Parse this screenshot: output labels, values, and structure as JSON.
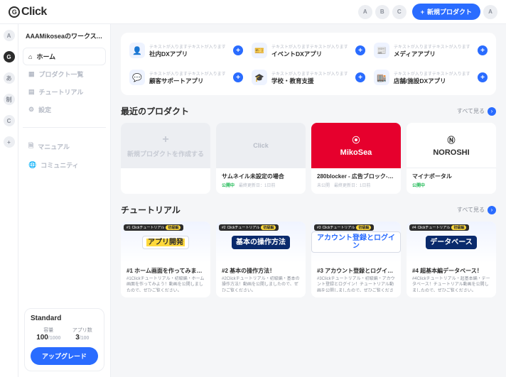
{
  "brand": "Click",
  "topbar": {
    "avatars": [
      "A",
      "B",
      "C"
    ],
    "new_product": "新規プロダクト",
    "trail": "A"
  },
  "rail": [
    "A",
    "G",
    "あ",
    "制",
    "C",
    "+"
  ],
  "workspace": "AAAMikoseaのワークスペ...",
  "nav": {
    "home": "ホーム",
    "products": "プロダクト一覧",
    "tutorials": "チュートリアル",
    "settings": "設定",
    "manual": "マニュアル",
    "community": "コミュニティ"
  },
  "plan": {
    "name": "Standard",
    "cap_lbl": "容量",
    "cap_val": "100",
    "cap_max": "/1000",
    "app_lbl": "アプリ数",
    "app_val": "3",
    "app_max": "/100",
    "upgrade": "アップグレード"
  },
  "templates": [
    {
      "sub": "テキストが入りますテキストが入ります",
      "title": "社内DXアプリ",
      "icon": "👤"
    },
    {
      "sub": "テキストが入りますテキストが入ります",
      "title": "イベントDXアプリ",
      "icon": "🎫"
    },
    {
      "sub": "テキストが入りますテキストが入ります",
      "title": "メディアアプリ",
      "icon": "📰"
    },
    {
      "sub": "テキストが入りますテキストが入ります",
      "title": "顧客サポートアプリ",
      "icon": "💬"
    },
    {
      "sub": "テキストが入りますテキストが入ります",
      "title": "学校・教育支援",
      "icon": "🎓"
    },
    {
      "sub": "テキストが入りますテキストが入ります",
      "title": "店舗/施設DXアプリ",
      "icon": "🏬"
    }
  ],
  "recent": {
    "heading": "最近のプロダクト",
    "see_all": "すべて見る",
    "new_label": "新規プロダクトを作成する",
    "items": [
      {
        "title": "サムネイル未設定の場合",
        "status": "公開中",
        "updated": "最終更新日：1日前",
        "thumb": "Click"
      },
      {
        "title": "280blocker - 広告ブロック-コ...",
        "status": "未公開",
        "updated": "最終更新日：1日前",
        "thumb": "MikoSea"
      },
      {
        "title": "マイナポータル",
        "status": "公開中",
        "updated": "",
        "thumb": "NOROSHI"
      }
    ]
  },
  "tutorials": {
    "heading": "チュートリアル",
    "see_all": "すべて見る",
    "tag_label": "Clickチュートリアル",
    "tag_pill": "初級編",
    "items": [
      {
        "num": "#1",
        "hero": "アプリ開発",
        "title": "#1 ホーム画面を作ってみまし...",
        "desc": "#1Clickチュートリアル・初級編・ホーム画面を作ってみよう！動画を公開しましたので、ぜひご覧ください。"
      },
      {
        "num": "#2",
        "hero": "基本の操作方法",
        "title": "#2 基本の操作方法！",
        "desc": "#2Clickチュートリアル・初級編・基本の操作方法！動画を公開しましたので、ぜひご覧ください。"
      },
      {
        "num": "#3",
        "hero": "アカウント登録とログイン",
        "title": "#3 アカウント登録とログイン！",
        "desc": "#3Clickチュートリアル・初級編・アカウント登録とログイン！チュートリアル動画を公開しましたので、ぜひご覧ください。"
      },
      {
        "num": "#4",
        "hero": "データベース",
        "title": "#4 超基本編データベース！",
        "desc": "#4Clickチュートリアル・超基本編・データベース！チュートリアル動画を公開しましたので、ぜひご覧ください。"
      }
    ]
  }
}
